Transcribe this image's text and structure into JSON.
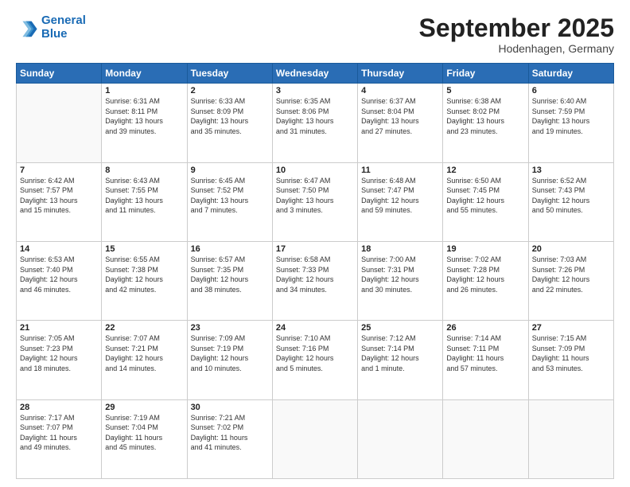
{
  "logo": {
    "line1": "General",
    "line2": "Blue"
  },
  "title": "September 2025",
  "location": "Hodenhagen, Germany",
  "weekdays": [
    "Sunday",
    "Monday",
    "Tuesday",
    "Wednesday",
    "Thursday",
    "Friday",
    "Saturday"
  ],
  "weeks": [
    [
      {
        "day": "",
        "info": ""
      },
      {
        "day": "1",
        "info": "Sunrise: 6:31 AM\nSunset: 8:11 PM\nDaylight: 13 hours\nand 39 minutes."
      },
      {
        "day": "2",
        "info": "Sunrise: 6:33 AM\nSunset: 8:09 PM\nDaylight: 13 hours\nand 35 minutes."
      },
      {
        "day": "3",
        "info": "Sunrise: 6:35 AM\nSunset: 8:06 PM\nDaylight: 13 hours\nand 31 minutes."
      },
      {
        "day": "4",
        "info": "Sunrise: 6:37 AM\nSunset: 8:04 PM\nDaylight: 13 hours\nand 27 minutes."
      },
      {
        "day": "5",
        "info": "Sunrise: 6:38 AM\nSunset: 8:02 PM\nDaylight: 13 hours\nand 23 minutes."
      },
      {
        "day": "6",
        "info": "Sunrise: 6:40 AM\nSunset: 7:59 PM\nDaylight: 13 hours\nand 19 minutes."
      }
    ],
    [
      {
        "day": "7",
        "info": "Sunrise: 6:42 AM\nSunset: 7:57 PM\nDaylight: 13 hours\nand 15 minutes."
      },
      {
        "day": "8",
        "info": "Sunrise: 6:43 AM\nSunset: 7:55 PM\nDaylight: 13 hours\nand 11 minutes."
      },
      {
        "day": "9",
        "info": "Sunrise: 6:45 AM\nSunset: 7:52 PM\nDaylight: 13 hours\nand 7 minutes."
      },
      {
        "day": "10",
        "info": "Sunrise: 6:47 AM\nSunset: 7:50 PM\nDaylight: 13 hours\nand 3 minutes."
      },
      {
        "day": "11",
        "info": "Sunrise: 6:48 AM\nSunset: 7:47 PM\nDaylight: 12 hours\nand 59 minutes."
      },
      {
        "day": "12",
        "info": "Sunrise: 6:50 AM\nSunset: 7:45 PM\nDaylight: 12 hours\nand 55 minutes."
      },
      {
        "day": "13",
        "info": "Sunrise: 6:52 AM\nSunset: 7:43 PM\nDaylight: 12 hours\nand 50 minutes."
      }
    ],
    [
      {
        "day": "14",
        "info": "Sunrise: 6:53 AM\nSunset: 7:40 PM\nDaylight: 12 hours\nand 46 minutes."
      },
      {
        "day": "15",
        "info": "Sunrise: 6:55 AM\nSunset: 7:38 PM\nDaylight: 12 hours\nand 42 minutes."
      },
      {
        "day": "16",
        "info": "Sunrise: 6:57 AM\nSunset: 7:35 PM\nDaylight: 12 hours\nand 38 minutes."
      },
      {
        "day": "17",
        "info": "Sunrise: 6:58 AM\nSunset: 7:33 PM\nDaylight: 12 hours\nand 34 minutes."
      },
      {
        "day": "18",
        "info": "Sunrise: 7:00 AM\nSunset: 7:31 PM\nDaylight: 12 hours\nand 30 minutes."
      },
      {
        "day": "19",
        "info": "Sunrise: 7:02 AM\nSunset: 7:28 PM\nDaylight: 12 hours\nand 26 minutes."
      },
      {
        "day": "20",
        "info": "Sunrise: 7:03 AM\nSunset: 7:26 PM\nDaylight: 12 hours\nand 22 minutes."
      }
    ],
    [
      {
        "day": "21",
        "info": "Sunrise: 7:05 AM\nSunset: 7:23 PM\nDaylight: 12 hours\nand 18 minutes."
      },
      {
        "day": "22",
        "info": "Sunrise: 7:07 AM\nSunset: 7:21 PM\nDaylight: 12 hours\nand 14 minutes."
      },
      {
        "day": "23",
        "info": "Sunrise: 7:09 AM\nSunset: 7:19 PM\nDaylight: 12 hours\nand 10 minutes."
      },
      {
        "day": "24",
        "info": "Sunrise: 7:10 AM\nSunset: 7:16 PM\nDaylight: 12 hours\nand 5 minutes."
      },
      {
        "day": "25",
        "info": "Sunrise: 7:12 AM\nSunset: 7:14 PM\nDaylight: 12 hours\nand 1 minute."
      },
      {
        "day": "26",
        "info": "Sunrise: 7:14 AM\nSunset: 7:11 PM\nDaylight: 11 hours\nand 57 minutes."
      },
      {
        "day": "27",
        "info": "Sunrise: 7:15 AM\nSunset: 7:09 PM\nDaylight: 11 hours\nand 53 minutes."
      }
    ],
    [
      {
        "day": "28",
        "info": "Sunrise: 7:17 AM\nSunset: 7:07 PM\nDaylight: 11 hours\nand 49 minutes."
      },
      {
        "day": "29",
        "info": "Sunrise: 7:19 AM\nSunset: 7:04 PM\nDaylight: 11 hours\nand 45 minutes."
      },
      {
        "day": "30",
        "info": "Sunrise: 7:21 AM\nSunset: 7:02 PM\nDaylight: 11 hours\nand 41 minutes."
      },
      {
        "day": "",
        "info": ""
      },
      {
        "day": "",
        "info": ""
      },
      {
        "day": "",
        "info": ""
      },
      {
        "day": "",
        "info": ""
      }
    ]
  ]
}
